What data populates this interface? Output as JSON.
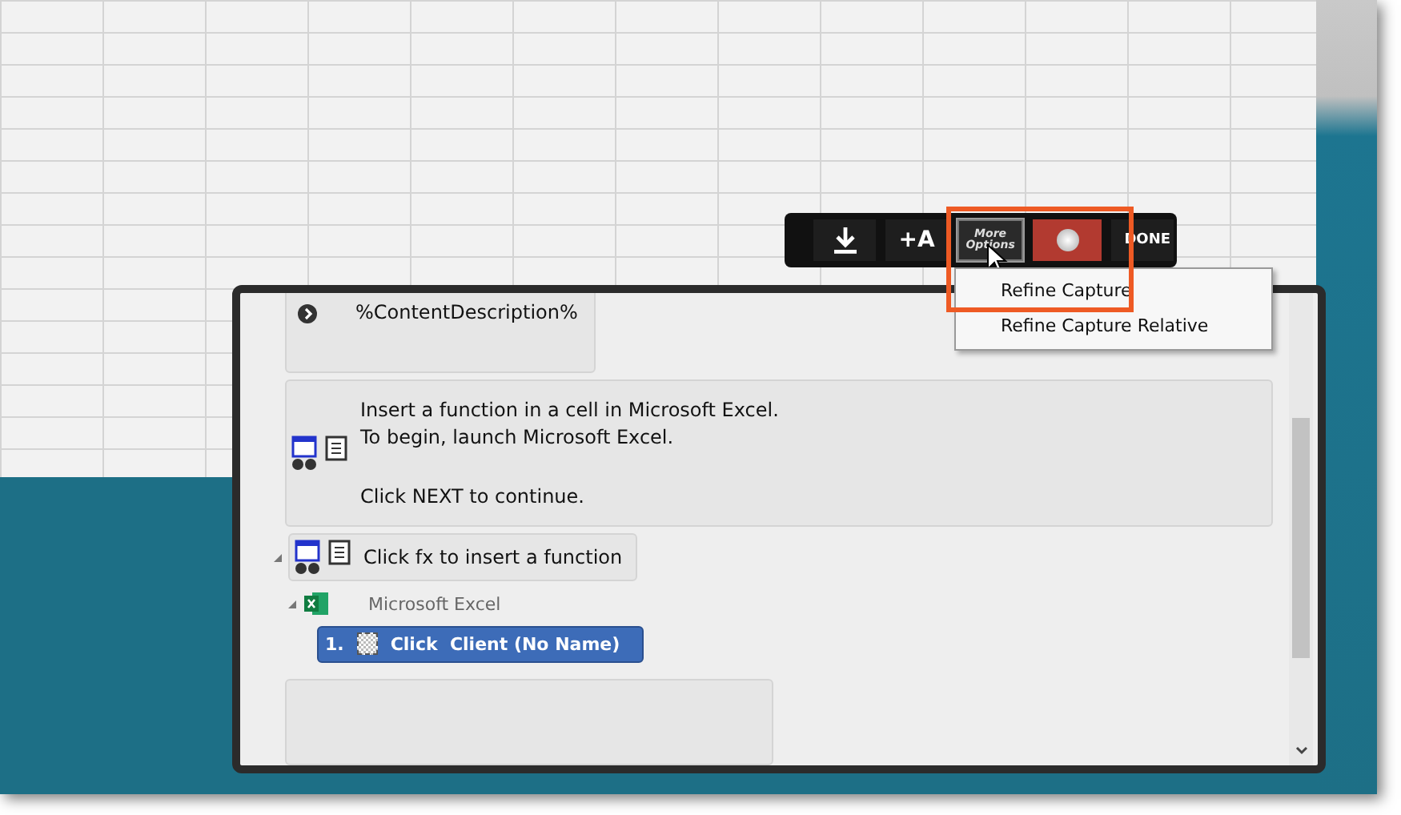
{
  "toolbar": {
    "buttons": [
      {
        "kind": "download",
        "selected": false
      },
      {
        "kind": "add-text",
        "label": "+A",
        "selected": false
      },
      {
        "kind": "more-options",
        "label": "More Options",
        "selected": true
      },
      {
        "kind": "record",
        "selected": false
      },
      {
        "kind": "done",
        "label": "DONE",
        "selected": false
      }
    ]
  },
  "menu": {
    "items": [
      {
        "label": "Refine Capture"
      },
      {
        "label": "Refine Capture Relative"
      }
    ]
  },
  "panel": {
    "items": [
      {
        "kind": "content",
        "text": "%ContentDescription%"
      },
      {
        "kind": "intro",
        "paragraphs": [
          [
            "Insert a function in a cell in Microsoft Excel.",
            "To begin, launch Microsoft Excel."
          ],
          [
            "Click NEXT to continue."
          ]
        ]
      },
      {
        "kind": "step",
        "text": "Click fx to insert a function",
        "expanded": true,
        "children": [
          {
            "kind": "app",
            "text": "Microsoft Excel",
            "expanded": true,
            "children": [
              {
                "kind": "action",
                "number": "1.",
                "text": "Click  Client (No Name)",
                "selected": true
              }
            ]
          }
        ]
      },
      {
        "kind": "end"
      }
    ]
  }
}
